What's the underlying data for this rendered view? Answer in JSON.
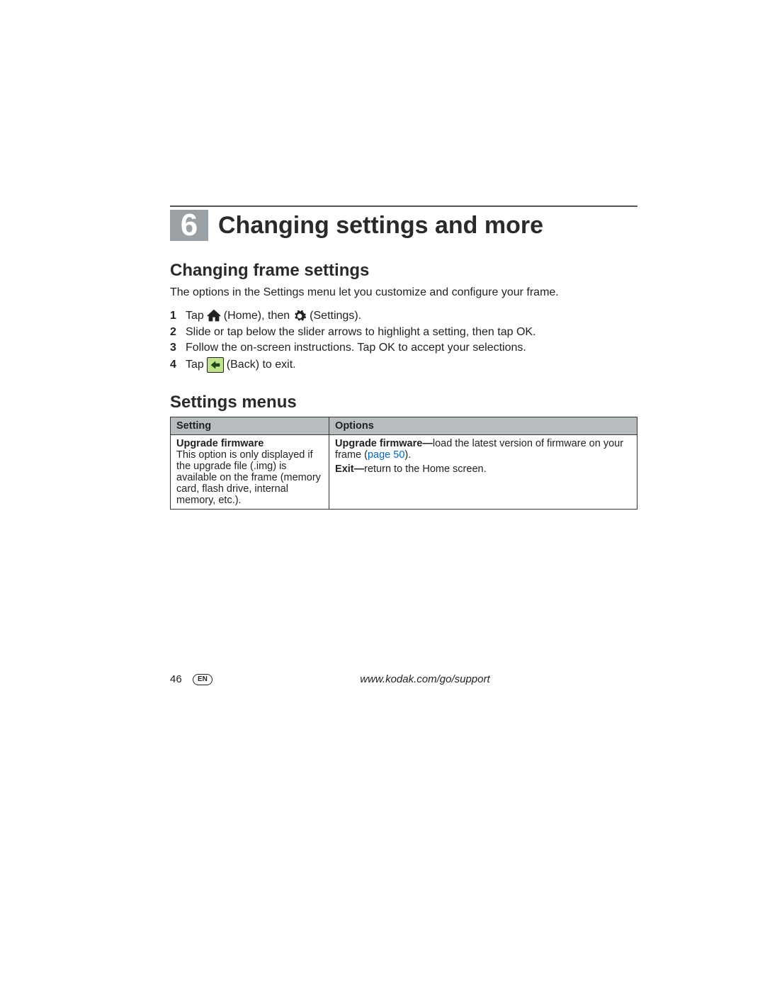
{
  "chapter": {
    "number": "6",
    "title": "Changing settings and more"
  },
  "section1": {
    "heading": "Changing frame settings",
    "intro": "The options in the Settings menu let you customize and configure your frame.",
    "steps": {
      "s1a": "Tap",
      "s1b": "(Home), then",
      "s1c": "(Settings).",
      "s2": "Slide or tap below the slider arrows to highlight a setting, then tap OK.",
      "s3": "Follow the on-screen instructions. Tap OK to accept your selections.",
      "s4a": "Tap",
      "s4b": "(Back) to exit."
    }
  },
  "section2": {
    "heading": "Settings menus",
    "table": {
      "h1": "Setting",
      "h2": "Options",
      "row1": {
        "setting_title": "Upgrade firmware",
        "setting_desc": "This option is only displayed if the upgrade file (.img) is available on the frame (memory card, flash drive, internal memory, etc.).",
        "opt1_label": "Upgrade firmware—",
        "opt1_text_a": "load the latest version of firmware on your frame (",
        "opt1_link": "page 50",
        "opt1_text_b": ").",
        "opt2_label": "Exit—",
        "opt2_text": "return to the Home screen."
      }
    }
  },
  "footer": {
    "page": "46",
    "lang": "EN",
    "url": "www.kodak.com/go/support"
  }
}
